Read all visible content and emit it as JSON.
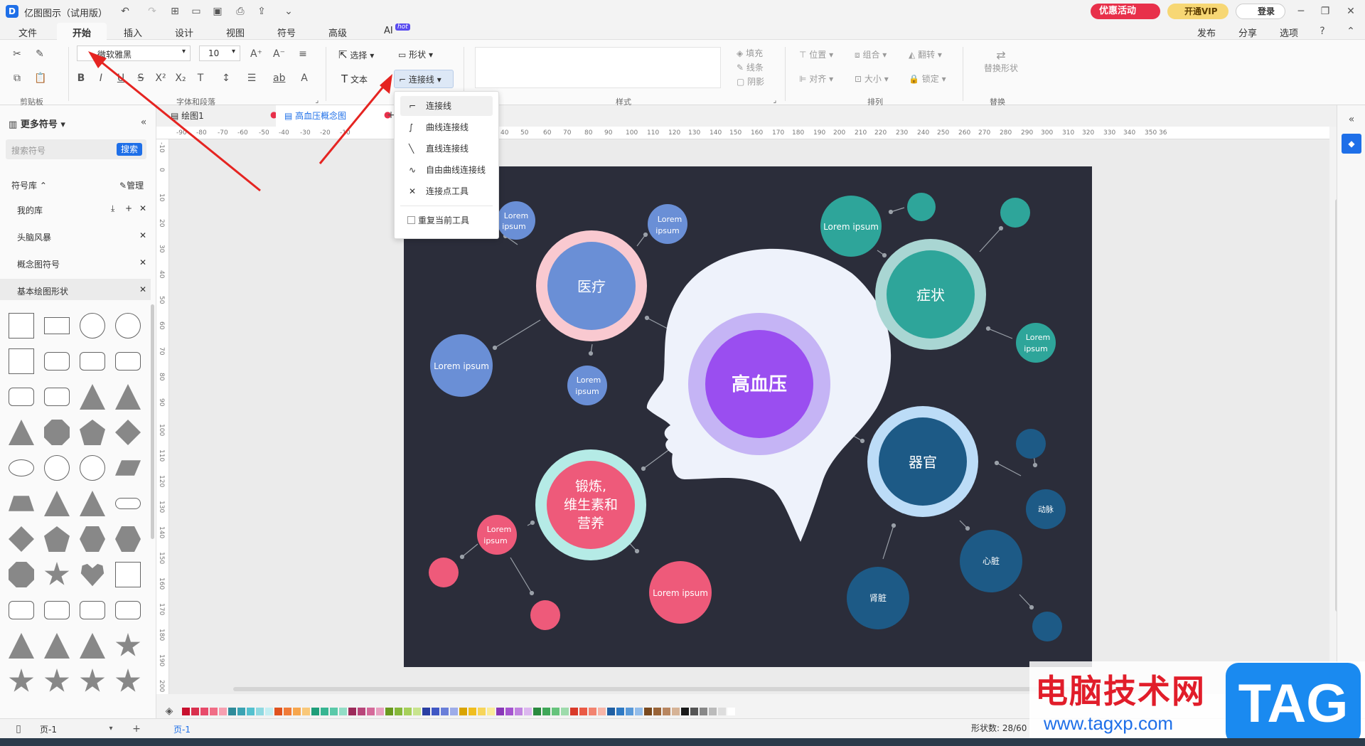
{
  "app": {
    "title": "亿图图示（试用版）",
    "promo": "优惠活动",
    "vip": "开通VIP",
    "login": "登录"
  },
  "menu": {
    "tabs": [
      "文件",
      "开始",
      "插入",
      "设计",
      "视图",
      "符号",
      "高级",
      "AI"
    ],
    "hot": "hot",
    "right": [
      "发布",
      "分享",
      "选项"
    ]
  },
  "ribbon": {
    "font_name": "微软雅黑",
    "font_size": "10",
    "select": "选择",
    "shape": "形状",
    "text": "文本",
    "connector": "连接线",
    "fill": "填充",
    "line": "线条",
    "shadow": "阴影",
    "position": "位置",
    "group": "组合",
    "flip": "翻转",
    "align": "对齐",
    "size": "大小",
    "lock": "锁定",
    "replace_shape": "替换形状",
    "groups": {
      "clipboard": "剪贴板",
      "font": "字体和段落",
      "style": "样式",
      "arrange": "排列",
      "replace": "替换"
    }
  },
  "dropdown": {
    "items": [
      "连接线",
      "曲线连接线",
      "直线连接线",
      "自由曲线连接线",
      "连接点工具"
    ],
    "repeat": "重复当前工具"
  },
  "sidebar": {
    "title": "更多符号",
    "search_placeholder": "搜索符号",
    "search_btn": "搜索",
    "library": "符号库",
    "manage": "管理",
    "items": [
      "我的库",
      "头脑风暴",
      "概念图符号",
      "基本绘图形状"
    ]
  },
  "tabs": {
    "doc1": "绘图1",
    "doc2": "高血压概念图"
  },
  "ruler": {
    "h": [
      "-90",
      "-80",
      "-70",
      "-60",
      "-50",
      "-40",
      "-30",
      "-20",
      "-10",
      "40",
      "50",
      "60",
      "70",
      "80",
      "90",
      "100",
      "110",
      "120",
      "130",
      "140",
      "150",
      "160",
      "170",
      "180",
      "190",
      "200",
      "210",
      "220",
      "230",
      "240",
      "250",
      "260",
      "270",
      "280",
      "290",
      "300",
      "310",
      "320",
      "330",
      "340",
      "350",
      "36"
    ],
    "v": [
      "-10",
      "0",
      "10",
      "20",
      "30",
      "40",
      "50",
      "60",
      "70",
      "80",
      "90",
      "100",
      "110",
      "120",
      "130",
      "140",
      "150",
      "160",
      "170",
      "180",
      "190",
      "200"
    ]
  },
  "diagram": {
    "center": "高血压",
    "medical": "医疗",
    "symptom": "症状",
    "organ": "器官",
    "exercise": [
      "锻炼,",
      "维生素和",
      "营养"
    ],
    "lorem_short": [
      "Lorem",
      "ipsum"
    ],
    "lorem_long": "Lorem ipsum",
    "artery": "动脉",
    "heart": "心脏",
    "kidney": "肾脏"
  },
  "status": {
    "page": "页-1",
    "page_tab": "页-1",
    "shapes": "形状数: 28/60"
  },
  "watermark": {
    "brand": "电脑技术网",
    "url": "www.tagxp.com",
    "tag": "TAG"
  },
  "palette": [
    "#c8102e",
    "#d9304e",
    "#e84a6a",
    "#f06d86",
    "#f7a0b1",
    "#2e8b9a",
    "#3aa3b3",
    "#54c1cf",
    "#8fd9e1",
    "#c4eef2",
    "#e0531f",
    "#f07b38",
    "#f7a64d",
    "#f9c87a",
    "#1f9e7a",
    "#37b592",
    "#5bc9a9",
    "#93ddc6",
    "#9c2a5a",
    "#b8467a",
    "#d56a9a",
    "#e8a0c0",
    "#6a9a1f",
    "#86b83a",
    "#a6d05a",
    "#c8e48e",
    "#2a3fa3",
    "#3f57c4",
    "#6a7fd9",
    "#9eade9",
    "#d9a400",
    "#f0be1f",
    "#f7d55a",
    "#faeb9a",
    "#8a38b8",
    "#a655d0",
    "#c184e0",
    "#dcb7ef",
    "#2a8a3f",
    "#3fa758",
    "#66c37c",
    "#9edbac",
    "#d93a2a",
    "#ea5a45",
    "#f2836f",
    "#f7b5a8",
    "#1f5fa3",
    "#2f7ac4",
    "#5a9ad9",
    "#93bdea",
    "#7a4a1f",
    "#9a6438",
    "#b88660",
    "#d6b396",
    "#1a1a1a",
    "#555555",
    "#888888",
    "#bbbbbb",
    "#dddddd",
    "#ffffff"
  ]
}
